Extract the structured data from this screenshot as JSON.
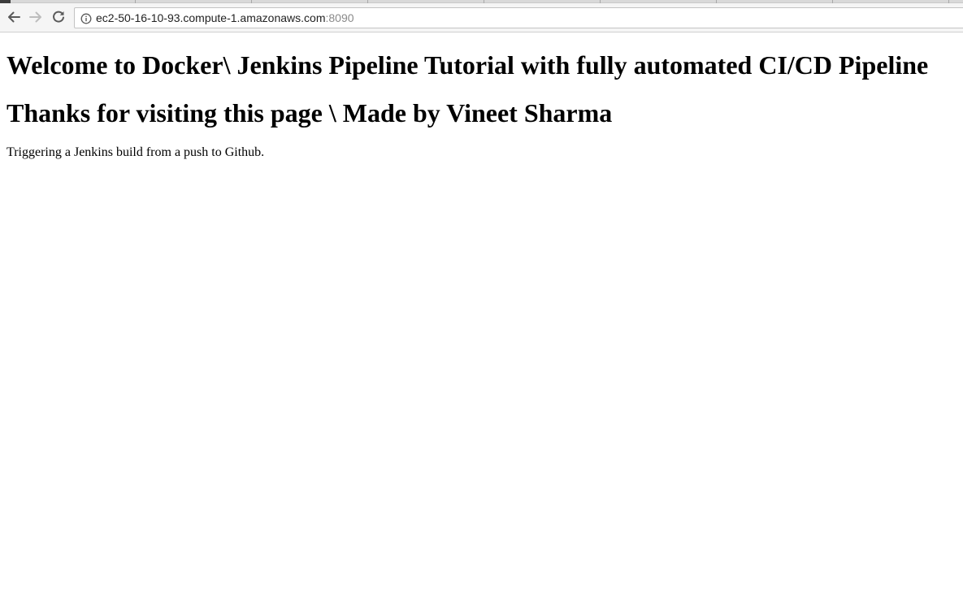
{
  "browser": {
    "url_host": "ec2-50-16-10-93.compute-1.amazonaws.com",
    "url_port": ":8090"
  },
  "icons": {
    "back": "arrow-left-icon",
    "forward": "arrow-right-icon",
    "reload": "reload-icon",
    "site_info": "info-icon"
  },
  "colors": {
    "toolbar_background": "#f5f5f5",
    "page_background": "#ffffff",
    "text": "#000000",
    "url_port": "#8a8a8a"
  },
  "page": {
    "heading_1": "Welcome to Docker\\ Jenkins Pipeline Tutorial with fully automated CI/CD Pipeline",
    "heading_2": "Thanks for visiting this page \\ Made by Vineet Sharma",
    "paragraph": "Triggering a Jenkins build from a push to Github."
  }
}
